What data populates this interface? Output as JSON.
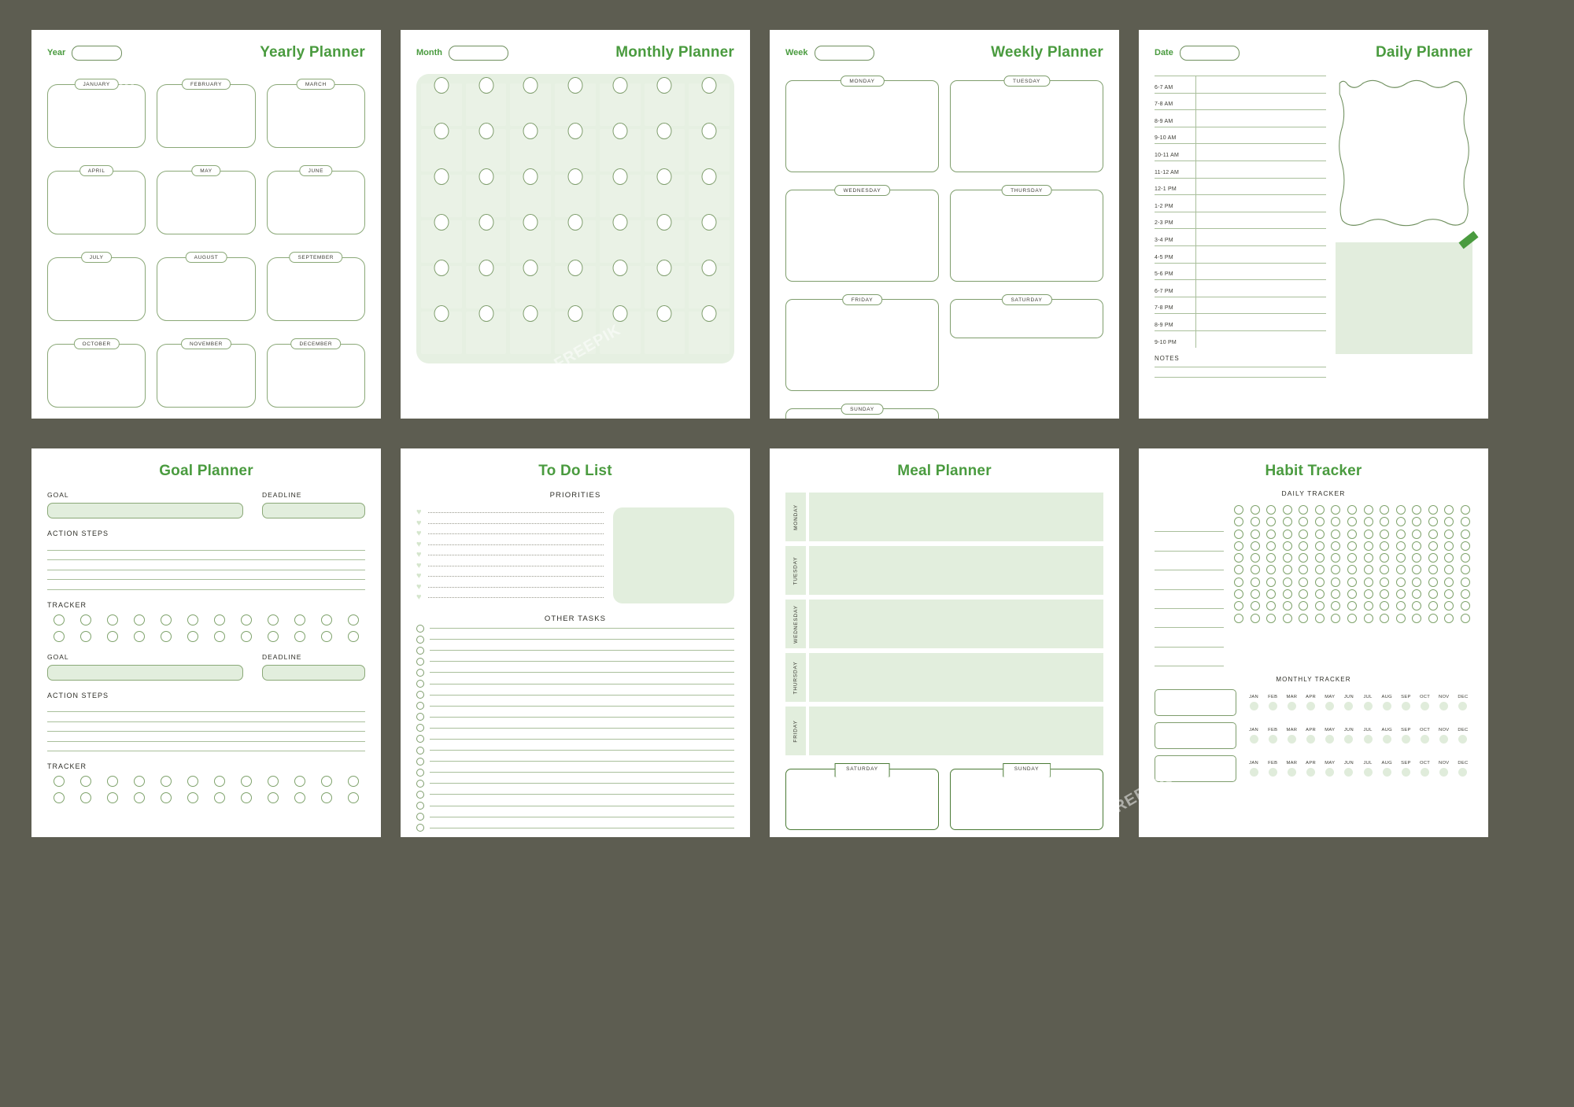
{
  "sheets": {
    "yearly": {
      "title": "Yearly Planner",
      "field_label": "Year",
      "field_value": "",
      "months": [
        "JANUARY",
        "FEBRUARY",
        "MARCH",
        "APRIL",
        "MAY",
        "JUNE",
        "JULY",
        "AUGUST",
        "SEPTEMBER",
        "OCTOBER",
        "NOVEMBER",
        "DECEMBER"
      ]
    },
    "monthly": {
      "title": "Monthly Planner",
      "field_label": "Month",
      "field_value": "",
      "columns": 7,
      "rows": 6
    },
    "weekly": {
      "title": "Weekly  Planner",
      "field_label": "Week",
      "field_value": "",
      "days": [
        "MONDAY",
        "TUESDAY",
        "WEDNESDAY",
        "THURSDAY",
        "FRIDAY",
        "SATURDAY",
        "SUNDAY"
      ]
    },
    "daily": {
      "title": "Daily Planner",
      "field_label": "Date",
      "field_value": "",
      "times": [
        "6-7 AM",
        "7-8 AM",
        "8-9 AM",
        "9-10 AM",
        "10-11 AM",
        "11-12 AM",
        "12-1 PM",
        "1-2 PM",
        "2-3 PM",
        "3-4 PM",
        "4-5 PM",
        "5-6 PM",
        "6-7 PM",
        "7-8 PM",
        "8-9 PM",
        "9-10 PM"
      ],
      "notes_label": "NOTES"
    },
    "goal": {
      "title": "Goal Planner",
      "blocks": [
        {
          "goal_label": "GOAL",
          "deadline_label": "DEADLINE",
          "action_label": "ACTION STEPS",
          "tracker_label": "TRACKER",
          "action_lines": 5,
          "tracker_rows": 2,
          "tracker_cols": 12
        },
        {
          "goal_label": "GOAL",
          "deadline_label": "DEADLINE",
          "action_label": "ACTION STEPS",
          "tracker_label": "TRACKER",
          "action_lines": 5,
          "tracker_rows": 2,
          "tracker_cols": 12
        }
      ]
    },
    "todo": {
      "title": "To Do List",
      "priorities_label": "PRIORITIES",
      "priorities_lines": 9,
      "other_label": "OTHER TASKS",
      "other_lines": 19
    },
    "meal": {
      "title": "Meal Planner",
      "weekdays": [
        "MONDAY",
        "TUESDAY",
        "WEDNESDAY",
        "THURSDAY",
        "FRIDAY"
      ],
      "weekend": [
        "SATURDAY",
        "SUNDAY"
      ]
    },
    "habit": {
      "title": "Habit Tracker",
      "daily_label": "DAILY TRACKER",
      "daily_rows": 10,
      "daily_cols": 15,
      "monthly_label": "MONTHLY TRACKER",
      "months_short": [
        "JAN",
        "FEB",
        "MAR",
        "APR",
        "MAY",
        "JUN",
        "JUL",
        "AUG",
        "SEP",
        "OCT",
        "NOV",
        "DEC"
      ],
      "monthly_rows": 3
    }
  },
  "colors": {
    "background": "#5d5d51",
    "paper": "#ffffff",
    "accent_green": "#4a9b3f",
    "line_green": "#8aa877",
    "fill_green": "#e2eedd"
  },
  "watermark": "FREEPIK"
}
